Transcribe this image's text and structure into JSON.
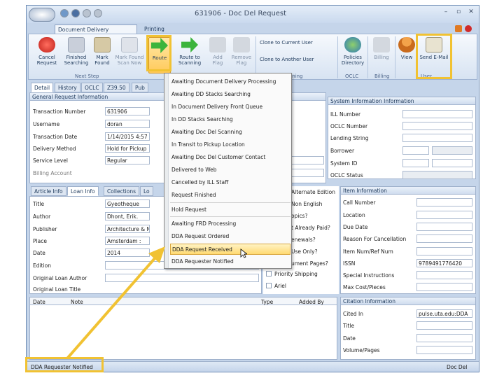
{
  "window": {
    "title": "631906 - Doc Del Request"
  },
  "ribbon_tabs": [
    {
      "label": "Document Delivery Processing"
    },
    {
      "label": "Printing"
    }
  ],
  "ribbon": {
    "cancel": "Cancel Request",
    "finished_searching": "Finished Searching",
    "mark_found": "Mark Found",
    "mark_found_scan_now": "Mark Found Scan Now",
    "route": "Route",
    "route_to_scanning": "Route to Scanning",
    "add_flag": "Add Flag",
    "remove_flag": "Remove Flag",
    "clone_current": "Clone to Current User",
    "clone_another": "Clone to Another User",
    "policies": "Policies Directory",
    "billing": "Billing",
    "view": "View",
    "send_email": "Send E-Mail",
    "groups": {
      "next_step": "Next Step",
      "cloning": "oning",
      "oclc": "OCLC",
      "billing": "Billing",
      "user": "User"
    }
  },
  "doc_tabs": [
    "Detail",
    "History",
    "OCLC",
    "Z39.50",
    "Pub"
  ],
  "general": {
    "header": "General Request Information",
    "fields": [
      {
        "label": "Transaction Number",
        "value": "631906"
      },
      {
        "label": "Username",
        "value": "doran"
      },
      {
        "label": "Transaction Date",
        "value": "1/14/2015 4:57"
      },
      {
        "label": "Delivery Method",
        "value": "Hold for Pickup"
      },
      {
        "label": "Service Level",
        "value": "Regular"
      },
      {
        "label": "Billing Account",
        "value": ""
      }
    ]
  },
  "system": {
    "header": "System Information Information",
    "fields": [
      "ILL Number",
      "OCLC Number",
      "Lending String",
      "Borrower",
      "System ID",
      "OCLC Status"
    ]
  },
  "loan_tabs": [
    "Article Info",
    "Loan Info",
    "Collections",
    "Lo"
  ],
  "loan": {
    "fields": [
      {
        "label": "Title",
        "value": "Gyeotheque"
      },
      {
        "label": "Author",
        "value": "Dhont, Erik."
      },
      {
        "label": "Publisher",
        "value": "Architecture & N"
      },
      {
        "label": "Place",
        "value": "Amsterdam :"
      },
      {
        "label": "Date",
        "value": "2014"
      },
      {
        "label": "Edition",
        "value": ""
      },
      {
        "label": "Original Loan Author",
        "value": ""
      },
      {
        "label": "Original Loan Title",
        "value": ""
      }
    ]
  },
  "options": {
    "items": [
      "Alternate Edition",
      "Non English",
      "opics?",
      "t Already Paid?",
      "enewals?",
      "Use Only?",
      "ument Pages?",
      "Priority Shipping",
      "Ariel"
    ]
  },
  "item_info": {
    "header": "Item Information",
    "fields": [
      {
        "label": "Call Number",
        "value": ""
      },
      {
        "label": "Location",
        "value": ""
      },
      {
        "label": "Due Date",
        "value": ""
      },
      {
        "label": "Reason For Cancellation",
        "value": ""
      },
      {
        "label": "Item Num/Ref Num",
        "value": ""
      },
      {
        "label": "ISSN",
        "value": "9789491776420"
      },
      {
        "label": "Special Instructions",
        "value": ""
      },
      {
        "label": "Max Cost/Pieces",
        "value": ""
      }
    ]
  },
  "notes_table": {
    "columns": [
      "Date",
      "Note",
      "Type",
      "Added By"
    ]
  },
  "citation": {
    "header": "Citation Information",
    "fields": [
      {
        "label": "Cited In",
        "value": "pulse.uta.edu:DDA"
      },
      {
        "label": "Title",
        "value": ""
      },
      {
        "label": "Date",
        "value": ""
      },
      {
        "label": "Volume/Pages",
        "value": ""
      }
    ]
  },
  "route_menu": {
    "items": [
      "Awaiting Document Delivery Processing",
      "Awaiting DD Stacks Searching",
      "In Document Delivery Front Queue",
      "In DD Stacks Searching",
      "Awaiting Doc Del Scanning",
      "In Transit to Pickup Location",
      "Awaiting Doc Del Customer Contact",
      "Delivered to Web",
      "Cancelled by ILL Staff",
      "Request Finished",
      "Hold Request",
      "Awaiting FRD Processing",
      "DDA Request Ordered",
      "DDA Request Received",
      "DDA Requester Notified"
    ],
    "highlighted": "DDA Request Received"
  },
  "status": {
    "left": "DDA Requester Notified",
    "right": "Doc Del"
  },
  "colors": {
    "highlight_box": "#f1c232",
    "arrow": "#f1c232"
  }
}
